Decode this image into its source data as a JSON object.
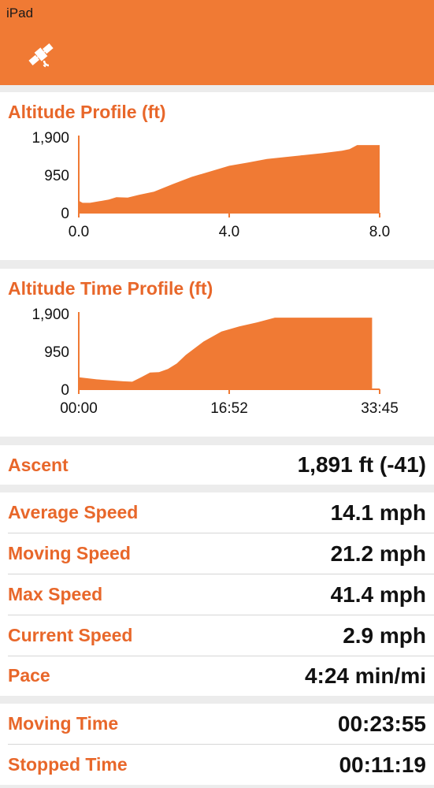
{
  "status_bar": {
    "carrier": "iPad"
  },
  "nav": {
    "icon": "satellite-icon"
  },
  "colors": {
    "accent": "#f07a34",
    "label": "#e8672a",
    "fill": "#f07a34"
  },
  "chart_data": [
    {
      "type": "area",
      "title": "Altitude Profile (ft)",
      "x": [
        0.0,
        0.1,
        0.3,
        0.8,
        1.0,
        1.3,
        1.6,
        2.0,
        2.5,
        3.0,
        3.5,
        4.0,
        4.5,
        5.0,
        5.5,
        6.0,
        6.5,
        7.0,
        7.2,
        7.4,
        8.0
      ],
      "y": [
        300,
        250,
        250,
        330,
        390,
        380,
        450,
        530,
        720,
        900,
        1040,
        1180,
        1260,
        1350,
        1400,
        1450,
        1500,
        1560,
        1600,
        1700,
        1700
      ],
      "xlim": [
        0,
        8
      ],
      "ylim": [
        0,
        1900
      ],
      "x_ticks": [
        "0.0",
        "4.0",
        "8.0"
      ],
      "y_ticks": [
        "1,900",
        "950",
        "0"
      ]
    },
    {
      "type": "area",
      "title": "Altitude Time Profile (ft)",
      "x": [
        0,
        2,
        5,
        6,
        7,
        8,
        9,
        10,
        11,
        12,
        14,
        16,
        18,
        20,
        22,
        22.5,
        32.9
      ],
      "y": [
        300,
        250,
        200,
        190,
        300,
        420,
        430,
        510,
        650,
        860,
        1200,
        1450,
        1580,
        1680,
        1800,
        1800,
        1800
      ],
      "xlim": [
        0,
        33.75
      ],
      "ylim": [
        0,
        1900
      ],
      "x_ticks": [
        "00:00",
        "16:52",
        "33:45"
      ],
      "y_ticks": [
        "1,900",
        "950",
        "0"
      ]
    }
  ],
  "stats": {
    "ascent": {
      "label": "Ascent",
      "value": "1,891 ft (-41)"
    },
    "average_speed": {
      "label": "Average Speed",
      "value": "14.1 mph"
    },
    "moving_speed": {
      "label": "Moving Speed",
      "value": "21.2 mph"
    },
    "max_speed": {
      "label": "Max Speed",
      "value": "41.4 mph"
    },
    "current_speed": {
      "label": "Current Speed",
      "value": "2.9 mph"
    },
    "pace": {
      "label": "Pace",
      "value": "4:24 min/mi"
    },
    "moving_time": {
      "label": "Moving Time",
      "value": "00:23:55"
    },
    "stopped_time": {
      "label": "Stopped Time",
      "value": "00:11:19"
    }
  }
}
